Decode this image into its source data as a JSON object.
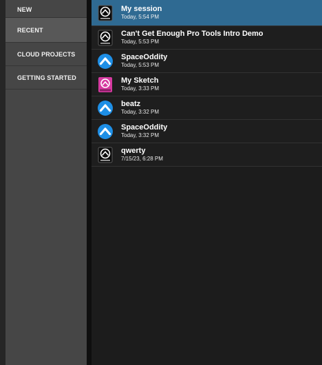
{
  "sidebar": {
    "items": [
      {
        "label": "NEW",
        "active": false
      },
      {
        "label": "RECENT",
        "active": true
      },
      {
        "label": "CLOUD PROJECTS",
        "active": false
      },
      {
        "label": "GETTING STARTED",
        "active": false
      }
    ]
  },
  "sessions": [
    {
      "name": "My session",
      "time": "Today, 5:54 PM",
      "icon": "protools-session-icon",
      "selected": true
    },
    {
      "name": "Can't Get Enough Pro Tools Intro Demo",
      "time": "Today, 5:53 PM",
      "icon": "protools-session-icon",
      "selected": false
    },
    {
      "name": "SpaceOddity",
      "time": "Today, 5:53 PM",
      "icon": "cloud-project-icon",
      "selected": false
    },
    {
      "name": "My Sketch",
      "time": "Today, 3:33 PM",
      "icon": "sketch-icon",
      "selected": false
    },
    {
      "name": "beatz",
      "time": "Today, 3:32 PM",
      "icon": "cloud-project-icon",
      "selected": false
    },
    {
      "name": "SpaceOddity",
      "time": "Today, 3:32 PM",
      "icon": "cloud-project-icon",
      "selected": false
    },
    {
      "name": "qwerty",
      "time": "7/15/23, 6:28 PM",
      "icon": "protools-session-icon",
      "selected": false
    }
  ],
  "colors": {
    "selected_row": "#2f6a92",
    "sidebar": "#464646",
    "sidebar_active": "#585858",
    "content_bg": "#1c1c1c",
    "cloud_icon": "#1e8fe6",
    "sketch_icon": "#d63aa0"
  }
}
